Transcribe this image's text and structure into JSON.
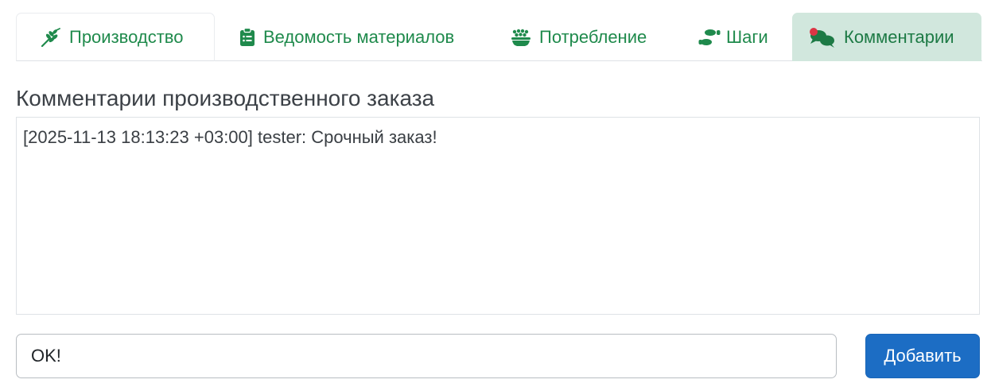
{
  "tabs": [
    {
      "label": "Производство",
      "icon": "wheat-icon"
    },
    {
      "label": "Ведомость материалов",
      "icon": "clipboard-list-icon"
    },
    {
      "label": "Потребление",
      "icon": "bowl-food-icon"
    },
    {
      "label": "Шаги",
      "icon": "shoe-prints-icon"
    },
    {
      "label": "Комментарии",
      "icon": "comments-icon",
      "active": true
    }
  ],
  "colors": {
    "accent": "#1f8a4c",
    "active_tab_bg": "#d1e7dd",
    "notification_dot": "#dc3545",
    "button_primary": "#1c6dc4"
  },
  "section": {
    "title": "Комментарии производственного заказа"
  },
  "log": {
    "lines": [
      "[2025-11-13 18:13:23 +03:00] tester: Срочный заказ!"
    ]
  },
  "comment_input": {
    "value": "OK!"
  },
  "add_button": {
    "label": "Добавить"
  }
}
